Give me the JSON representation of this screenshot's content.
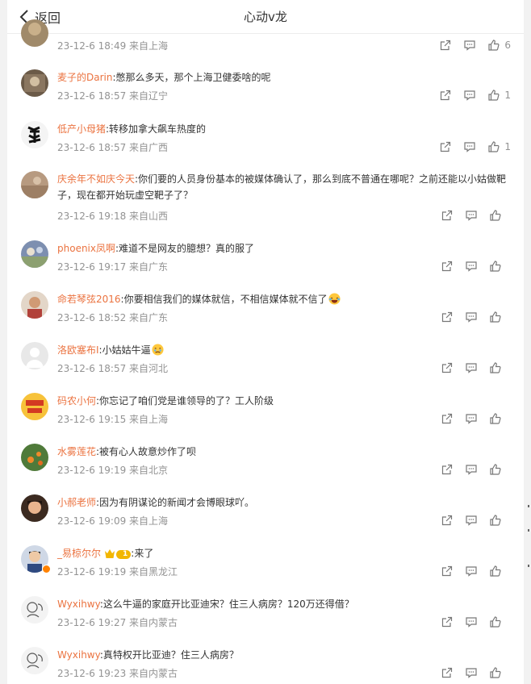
{
  "header": {
    "back_label": "返回",
    "title": "心动v龙"
  },
  "comments": [
    {
      "name": "",
      "text": "",
      "meta": "23-12-6 18:49 来自上海",
      "likes": "6"
    },
    {
      "name": "麦子的Darin",
      "text": ":憋那么多天，那个上海卫健委啥的呢",
      "meta": "23-12-6 18:57 来自辽宁",
      "likes": "1"
    },
    {
      "name": "低产小母猪",
      "text": ":转移加拿大飙车热度的",
      "meta": "23-12-6 18:57 来自广西",
      "likes": "1"
    },
    {
      "name": "庆余年不如庆今天",
      "text": ":你们要的人员身份基本的被媒体确认了，那么到底不普通在哪呢？之前还能以小姑做靶子，现在都开始玩虚空靶子了？",
      "meta": "23-12-6 19:18 来自山西",
      "likes": ""
    },
    {
      "name": "phoenix凤啊",
      "text": ":难道不是网友的臆想？真的服了",
      "meta": "23-12-6 19:17 来自广东",
      "likes": ""
    },
    {
      "name": "命若琴弦2016",
      "text": ":你要相信我们的媒体就信，不相信媒体就不信了",
      "meta": "23-12-6 18:52 来自广东",
      "likes": ""
    },
    {
      "name": "洛欧塞布I",
      "text": ":小姑姑牛逼",
      "meta": "23-12-6 18:57 来自河北",
      "likes": ""
    },
    {
      "name": "码农小何",
      "text": ":你忘记了咱们党是谁领导的了？工人阶级",
      "meta": "23-12-6 19:15 来自上海",
      "likes": ""
    },
    {
      "name": "水雾莲花",
      "text": ":被有心人故意炒作了呗",
      "meta": "23-12-6 19:19 来自北京",
      "likes": ""
    },
    {
      "name": "小郝老师",
      "text": ":因为有阴谋论的新闻才会博眼球吖。",
      "meta": "23-12-6 19:09 来自上海",
      "likes": ""
    },
    {
      "name": "_易椋尔尔",
      "text": ":来了",
      "meta": "23-12-6 19:19 来自黑龙江",
      "likes": ""
    },
    {
      "name": "Wyxihwy",
      "text": ":这么牛逼的家庭开比亚迪宋？住三人病房？120万还得借？",
      "meta": "23-12-6 19:27 来自内蒙古",
      "likes": ""
    },
    {
      "name": "Wyxihwy",
      "text": ":真特权开比亚迪？住三人病房？",
      "meta": "23-12-6 19:23 来自内蒙古",
      "likes": ""
    }
  ],
  "badges": {
    "crown_level": "1"
  },
  "colors": {
    "name": "#eb7340",
    "meta": "#939393",
    "text": "#333333",
    "vip": "#ff8200"
  },
  "icons": [
    "chevron-left-icon",
    "share-icon",
    "comment-icon",
    "like-icon",
    "crown-icon",
    "emoji-laugh-cry-icon",
    "emoji-sad-icon"
  ]
}
